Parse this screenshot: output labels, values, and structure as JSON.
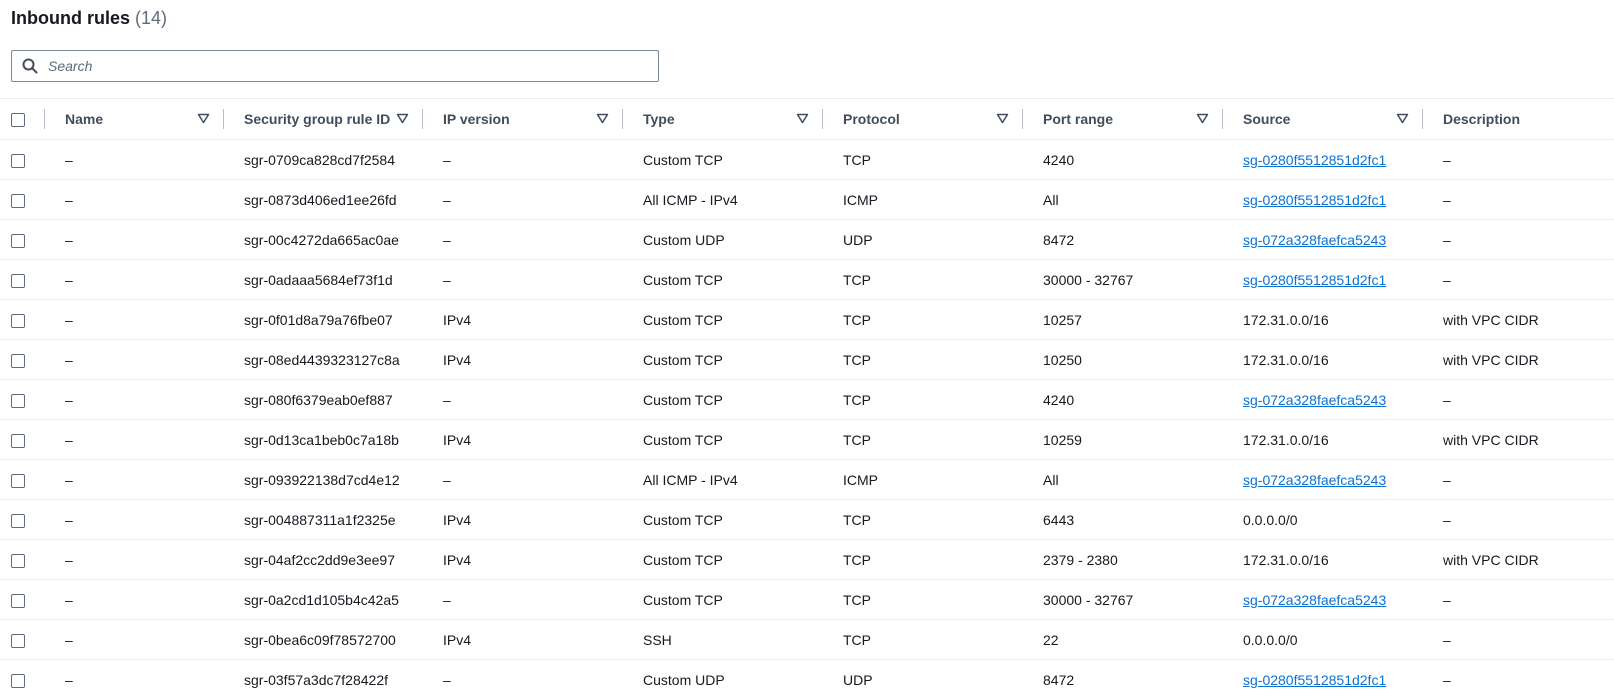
{
  "header": {
    "title": "Inbound rules",
    "count": "(14)"
  },
  "search": {
    "placeholder": "Search"
  },
  "columns": {
    "name": "Name",
    "sgr": "Security group rule ID",
    "ipv": "IP version",
    "type": "Type",
    "protocol": "Protocol",
    "port": "Port range",
    "source": "Source",
    "description": "Description"
  },
  "rows": [
    {
      "name": "–",
      "sgr": "sgr-0709ca828cd7f2584",
      "ipv": "–",
      "type": "Custom TCP",
      "protocol": "TCP",
      "port": "4240",
      "source": "sg-0280f5512851d2fc1",
      "source_link": true,
      "description": "–"
    },
    {
      "name": "–",
      "sgr": "sgr-0873d406ed1ee26fd",
      "ipv": "–",
      "type": "All ICMP - IPv4",
      "protocol": "ICMP",
      "port": "All",
      "source": "sg-0280f5512851d2fc1",
      "source_link": true,
      "description": "–"
    },
    {
      "name": "–",
      "sgr": "sgr-00c4272da665ac0ae",
      "ipv": "–",
      "type": "Custom UDP",
      "protocol": "UDP",
      "port": "8472",
      "source": "sg-072a328faefca5243",
      "source_link": true,
      "description": "–"
    },
    {
      "name": "–",
      "sgr": "sgr-0adaaa5684ef73f1d",
      "ipv": "–",
      "type": "Custom TCP",
      "protocol": "TCP",
      "port": "30000 - 32767",
      "source": "sg-0280f5512851d2fc1",
      "source_link": true,
      "description": "–"
    },
    {
      "name": "–",
      "sgr": "sgr-0f01d8a79a76fbe07",
      "ipv": "IPv4",
      "type": "Custom TCP",
      "protocol": "TCP",
      "port": "10257",
      "source": "172.31.0.0/16",
      "source_link": false,
      "description": "with VPC CIDR"
    },
    {
      "name": "–",
      "sgr": "sgr-08ed4439323127c8a",
      "ipv": "IPv4",
      "type": "Custom TCP",
      "protocol": "TCP",
      "port": "10250",
      "source": "172.31.0.0/16",
      "source_link": false,
      "description": "with VPC CIDR"
    },
    {
      "name": "–",
      "sgr": "sgr-080f6379eab0ef887",
      "ipv": "–",
      "type": "Custom TCP",
      "protocol": "TCP",
      "port": "4240",
      "source": "sg-072a328faefca5243",
      "source_link": true,
      "description": "–"
    },
    {
      "name": "–",
      "sgr": "sgr-0d13ca1beb0c7a18b",
      "ipv": "IPv4",
      "type": "Custom TCP",
      "protocol": "TCP",
      "port": "10259",
      "source": "172.31.0.0/16",
      "source_link": false,
      "description": "with VPC CIDR"
    },
    {
      "name": "–",
      "sgr": "sgr-093922138d7cd4e12",
      "ipv": "–",
      "type": "All ICMP - IPv4",
      "protocol": "ICMP",
      "port": "All",
      "source": "sg-072a328faefca5243",
      "source_link": true,
      "description": "–"
    },
    {
      "name": "–",
      "sgr": "sgr-004887311a1f2325e",
      "ipv": "IPv4",
      "type": "Custom TCP",
      "protocol": "TCP",
      "port": "6443",
      "source": "0.0.0.0/0",
      "source_link": false,
      "description": "–"
    },
    {
      "name": "–",
      "sgr": "sgr-04af2cc2dd9e3ee97",
      "ipv": "IPv4",
      "type": "Custom TCP",
      "protocol": "TCP",
      "port": "2379 - 2380",
      "source": "172.31.0.0/16",
      "source_link": false,
      "description": "with VPC CIDR"
    },
    {
      "name": "–",
      "sgr": "sgr-0a2cd1d105b4c42a5",
      "ipv": "–",
      "type": "Custom TCP",
      "protocol": "TCP",
      "port": "30000 - 32767",
      "source": "sg-072a328faefca5243",
      "source_link": true,
      "description": "–"
    },
    {
      "name": "–",
      "sgr": "sgr-0bea6c09f78572700",
      "ipv": "IPv4",
      "type": "SSH",
      "protocol": "TCP",
      "port": "22",
      "source": "0.0.0.0/0",
      "source_link": false,
      "description": "–"
    },
    {
      "name": "–",
      "sgr": "sgr-03f57a3dc7f28422f",
      "ipv": "–",
      "type": "Custom UDP",
      "protocol": "UDP",
      "port": "8472",
      "source": "sg-0280f5512851d2fc1",
      "source_link": true,
      "description": "–"
    }
  ],
  "colors": {
    "link": "#0972d3",
    "border": "#e9ebed",
    "header_text": "#414d5c"
  }
}
